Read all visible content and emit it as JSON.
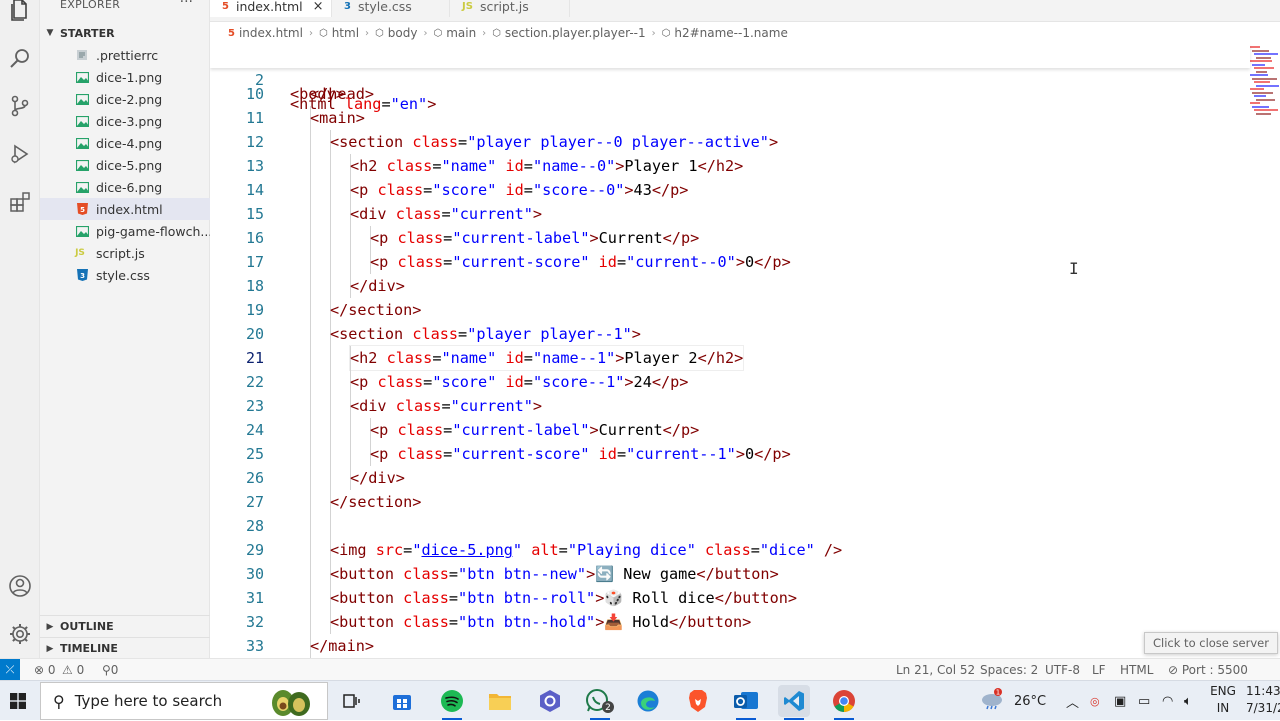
{
  "explorer": {
    "title": "EXPLORER",
    "more": "···",
    "folder": "STARTER",
    "files": [
      {
        "name": ".prettierrc",
        "icon": "settings-file-icon",
        "color": "#6d8086"
      },
      {
        "name": "dice-1.png",
        "icon": "image-file-icon",
        "color": "#26a269"
      },
      {
        "name": "dice-2.png",
        "icon": "image-file-icon",
        "color": "#26a269"
      },
      {
        "name": "dice-3.png",
        "icon": "image-file-icon",
        "color": "#26a269"
      },
      {
        "name": "dice-4.png",
        "icon": "image-file-icon",
        "color": "#26a269"
      },
      {
        "name": "dice-5.png",
        "icon": "image-file-icon",
        "color": "#26a269"
      },
      {
        "name": "dice-6.png",
        "icon": "image-file-icon",
        "color": "#26a269"
      },
      {
        "name": "index.html",
        "icon": "html-file-icon",
        "color": "#e44d26",
        "active": true
      },
      {
        "name": "pig-game-flowch...",
        "icon": "image-file-icon",
        "color": "#26a269"
      },
      {
        "name": "script.js",
        "icon": "js-file-icon",
        "color": "#cbcb41"
      },
      {
        "name": "style.css",
        "icon": "css-file-icon",
        "color": "#1572b6"
      }
    ],
    "outline": "OUTLINE",
    "timeline": "TIMELINE"
  },
  "tabs": [
    {
      "label": "index.html",
      "icon_text": "5",
      "color": "#e44d26",
      "active": true,
      "close": "×"
    },
    {
      "label": "style.css",
      "icon_text": "3",
      "color": "#1572b6",
      "active": false
    },
    {
      "label": "script.js",
      "icon_text": "JS",
      "color": "#cbcb41",
      "active": false
    }
  ],
  "breadcrumb": [
    "index.html",
    "html",
    "body",
    "main",
    "section.player.player--1",
    "h2#name--1.name"
  ],
  "editor": {
    "sticky": {
      "num": "2",
      "text": "<html lang=\"en\">"
    },
    "partial_line": "</head>",
    "lines": [
      {
        "num": "10",
        "indent": 1,
        "html": "<body>"
      },
      {
        "num": "11",
        "indent": 2,
        "html": "<main>"
      },
      {
        "num": "12",
        "indent": 3,
        "html": "<section class=\"player player--0 player--active\">"
      },
      {
        "num": "13",
        "indent": 4,
        "html": "<h2 class=\"name\" id=\"name--0\">Player 1</h2>"
      },
      {
        "num": "14",
        "indent": 4,
        "html": "<p class=\"score\" id=\"score--0\">43</p>"
      },
      {
        "num": "15",
        "indent": 4,
        "html": "<div class=\"current\">"
      },
      {
        "num": "16",
        "indent": 5,
        "html": "<p class=\"current-label\">Current</p>"
      },
      {
        "num": "17",
        "indent": 5,
        "html": "<p class=\"current-score\" id=\"current--0\">0</p>"
      },
      {
        "num": "18",
        "indent": 4,
        "html": "</div>"
      },
      {
        "num": "19",
        "indent": 3,
        "html": "</section>"
      },
      {
        "num": "20",
        "indent": 3,
        "html": "<section class=\"player player--1\">"
      },
      {
        "num": "21",
        "indent": 4,
        "html": "<h2 class=\"name\" id=\"name--1\">Player 2</h2>",
        "current": true
      },
      {
        "num": "22",
        "indent": 4,
        "html": "<p class=\"score\" id=\"score--1\">24</p>"
      },
      {
        "num": "23",
        "indent": 4,
        "html": "<div class=\"current\">"
      },
      {
        "num": "24",
        "indent": 5,
        "html": "<p class=\"current-label\">Current</p>"
      },
      {
        "num": "25",
        "indent": 5,
        "html": "<p class=\"current-score\" id=\"current--1\">0</p>"
      },
      {
        "num": "26",
        "indent": 4,
        "html": "</div>"
      },
      {
        "num": "27",
        "indent": 3,
        "html": "</section>"
      },
      {
        "num": "28",
        "indent": 3,
        "html": ""
      },
      {
        "num": "29",
        "indent": 3,
        "html": "<img src=\"dice-5.png\" alt=\"Playing dice\" class=\"dice\" />"
      },
      {
        "num": "30",
        "indent": 3,
        "html": "<button class=\"btn btn--new\">🔄 New game</button>"
      },
      {
        "num": "31",
        "indent": 3,
        "html": "<button class=\"btn btn--roll\">🎲 Roll dice</button>"
      },
      {
        "num": "32",
        "indent": 3,
        "html": "<button class=\"btn btn--hold\">📥 Hold</button>"
      },
      {
        "num": "33",
        "indent": 2,
        "html": "</main>"
      }
    ]
  },
  "statusbar": {
    "errors": "⊗ 0",
    "warnings": "⚠ 0",
    "ports": "⚲0",
    "position": "Ln 21, Col 52",
    "spaces": "Spaces: 2",
    "encoding": "UTF-8",
    "eol": "LF",
    "language": "HTML",
    "port": "⊘ Port : 5500",
    "tooltip": "Click to close server"
  },
  "taskbar": {
    "search_placeholder": "Type here to search",
    "temperature": "26°C",
    "language": "ENG",
    "region": "IN",
    "time": "11:43",
    "date": "7/31/2"
  },
  "colors": {
    "tag": "#800000",
    "attr": "#e50000",
    "value": "#0000ff",
    "text": "#000000",
    "accent": "#007acc"
  }
}
